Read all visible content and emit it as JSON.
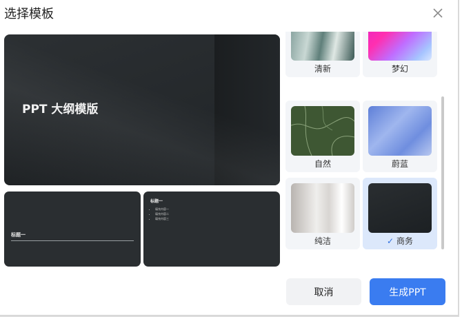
{
  "dialog": {
    "title": "选择模板",
    "close_icon": "close-icon"
  },
  "preview": {
    "main_title": "PPT 大纲模版",
    "slide_a_title": "标题一",
    "slide_b_title": "标题一",
    "slide_b_bullets": [
      "填充内容一",
      "填充内容二",
      "填充内容三"
    ]
  },
  "templates": [
    {
      "label": "清新",
      "selected": false
    },
    {
      "label": "梦幻",
      "selected": false
    },
    {
      "label": "自然",
      "selected": false
    },
    {
      "label": "蔚蓝",
      "selected": false
    },
    {
      "label": "纯洁",
      "selected": false
    },
    {
      "label": "商务",
      "selected": true,
      "check_icon": "check-icon"
    }
  ],
  "buttons": {
    "cancel_label": "取消",
    "generate_label": "生成PPT"
  },
  "colors": {
    "accent": "#3a7cf0",
    "selected_card": "#dce8fb",
    "card_bg": "#f3f5f8"
  }
}
